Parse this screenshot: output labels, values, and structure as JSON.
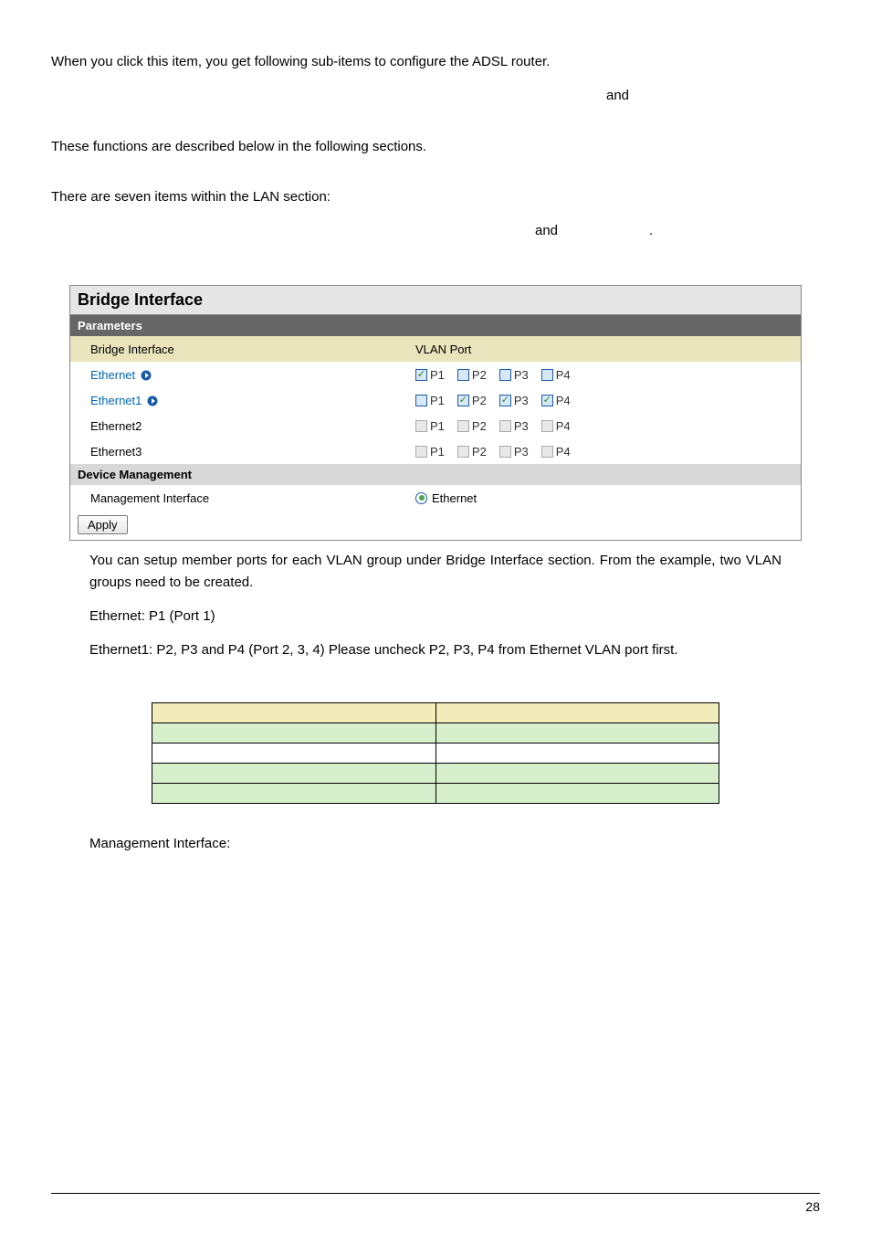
{
  "intro1": "When you click this item, you get following sub-items to configure the ADSL router.",
  "and1": "and",
  "intro2": "These functions are described below in the following sections.",
  "lan_intro": "There are seven items within the LAN section:",
  "and2": "and",
  "dot": ".",
  "panel": {
    "title": "Bridge Interface",
    "sub1": "Parameters",
    "col1": "Bridge Interface",
    "col2": "VLAN Port",
    "rows": [
      {
        "label": "Ethernet",
        "link": true,
        "ports": [
          {
            "l": "P1",
            "c": true,
            "d": false
          },
          {
            "l": "P2",
            "c": false,
            "d": false
          },
          {
            "l": "P3",
            "c": false,
            "d": false
          },
          {
            "l": "P4",
            "c": false,
            "d": false
          }
        ]
      },
      {
        "label": "Ethernet1",
        "link": true,
        "ports": [
          {
            "l": "P1",
            "c": false,
            "d": false
          },
          {
            "l": "P2",
            "c": true,
            "d": false
          },
          {
            "l": "P3",
            "c": true,
            "d": false
          },
          {
            "l": "P4",
            "c": true,
            "d": false
          }
        ]
      },
      {
        "label": "Ethernet2",
        "link": false,
        "ports": [
          {
            "l": "P1",
            "c": false,
            "d": true
          },
          {
            "l": "P2",
            "c": false,
            "d": true
          },
          {
            "l": "P3",
            "c": false,
            "d": true
          },
          {
            "l": "P4",
            "c": false,
            "d": true
          }
        ]
      },
      {
        "label": "Ethernet3",
        "link": false,
        "ports": [
          {
            "l": "P1",
            "c": false,
            "d": true
          },
          {
            "l": "P2",
            "c": false,
            "d": true
          },
          {
            "l": "P3",
            "c": false,
            "d": true
          },
          {
            "l": "P4",
            "c": false,
            "d": true
          }
        ]
      }
    ],
    "sub2": "Device Management",
    "mgmt_label": "Management Interface",
    "mgmt_value": "Ethernet",
    "apply": "Apply"
  },
  "para1": "You can setup member ports for each VLAN group under Bridge Interface section. From the example, two VLAN groups need to be created.",
  "para2": "Ethernet: P1 (Port 1)",
  "para3": "Ethernet1: P2, P3 and P4 (Port 2, 3, 4) Please uncheck P2, P3, P4 from Ethernet VLAN port first.",
  "mgmt_para": "Management  Interface:",
  "page_number": "28"
}
